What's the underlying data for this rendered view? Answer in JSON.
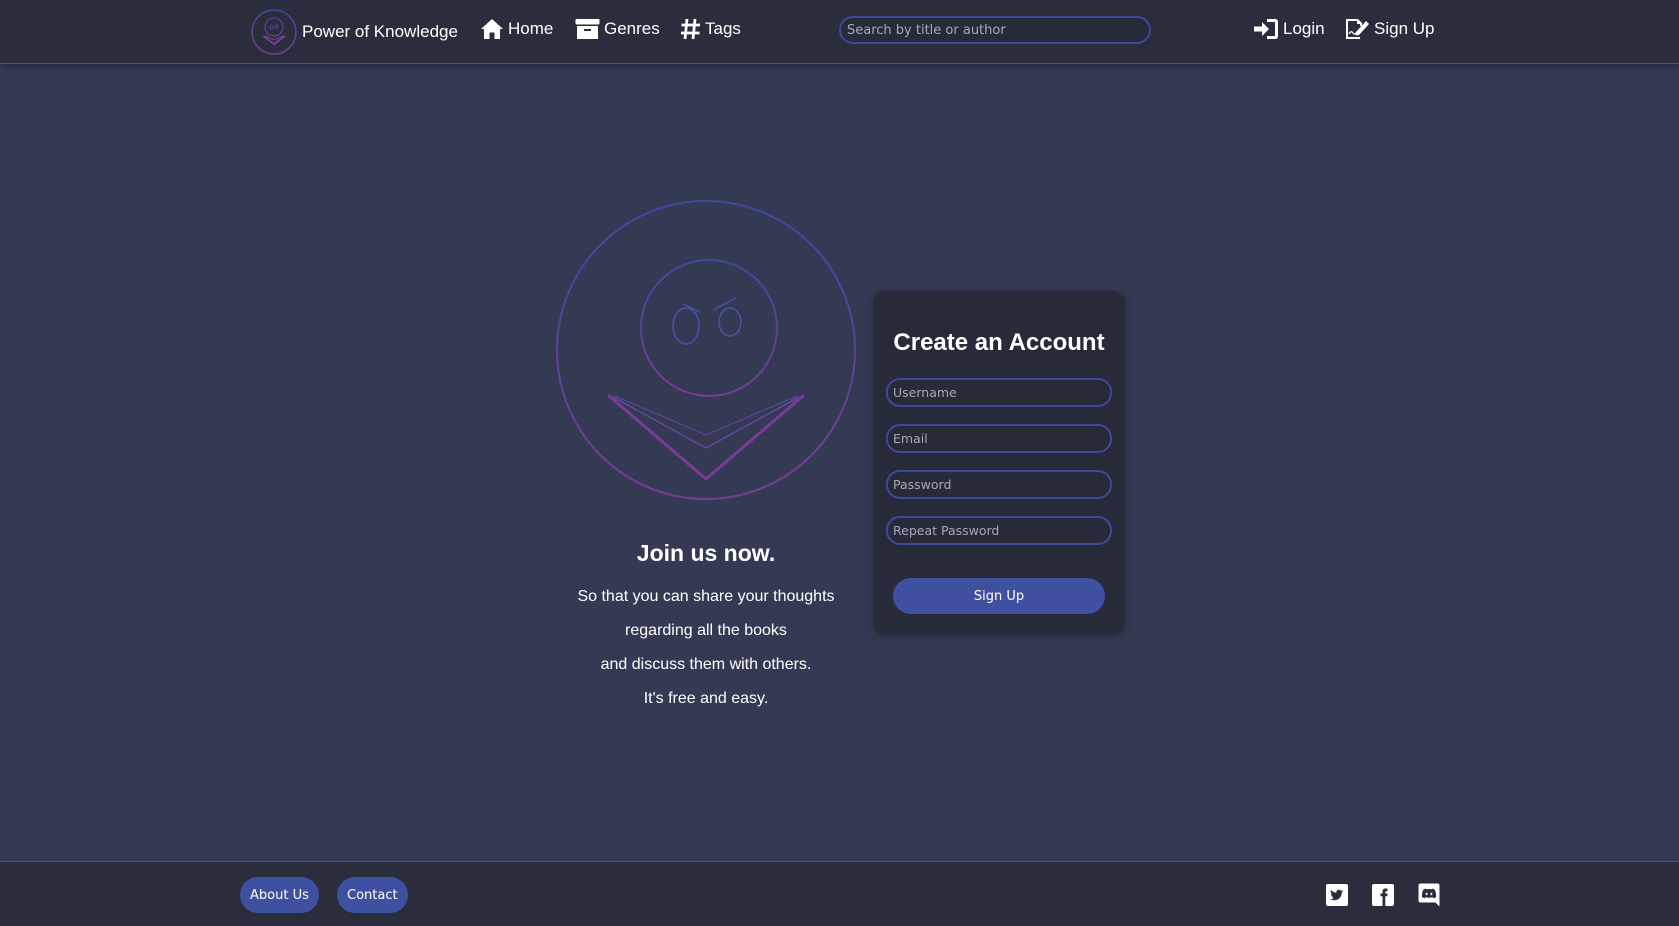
{
  "navbar": {
    "brand": "Power of Knowledge",
    "links": [
      {
        "label": "Home",
        "icon": "home-icon"
      },
      {
        "label": "Genres",
        "icon": "archive-box-icon"
      },
      {
        "label": "Tags",
        "icon": "hashtag-icon"
      }
    ],
    "search": {
      "placeholder": "Search by title or author",
      "value": ""
    },
    "login": {
      "label": "Login",
      "icon": "sign-in-icon"
    },
    "signup": {
      "label": "Sign Up",
      "icon": "signature-icon"
    }
  },
  "intro": {
    "title": "Join us now.",
    "lines": [
      "So that you can share your thoughts",
      "regarding all the books",
      "and discuss them with others.",
      "It's free and easy."
    ]
  },
  "form": {
    "title": "Create an Account",
    "fields": [
      {
        "placeholder": "Username",
        "value": ""
      },
      {
        "placeholder": "Email",
        "value": ""
      },
      {
        "placeholder": "Password",
        "value": ""
      },
      {
        "placeholder": "Repeat Password",
        "value": ""
      }
    ],
    "submit": "Sign Up"
  },
  "footer": {
    "about": "About Us",
    "contact": "Contact",
    "social": [
      "twitter-icon",
      "facebook-icon",
      "discord-icon"
    ]
  },
  "colors": {
    "background": "#343a54",
    "navbar": "#2a2d3c",
    "card": "#262a39",
    "accent_blue": "#4050a0",
    "accent_purple": "#6a3e86"
  }
}
